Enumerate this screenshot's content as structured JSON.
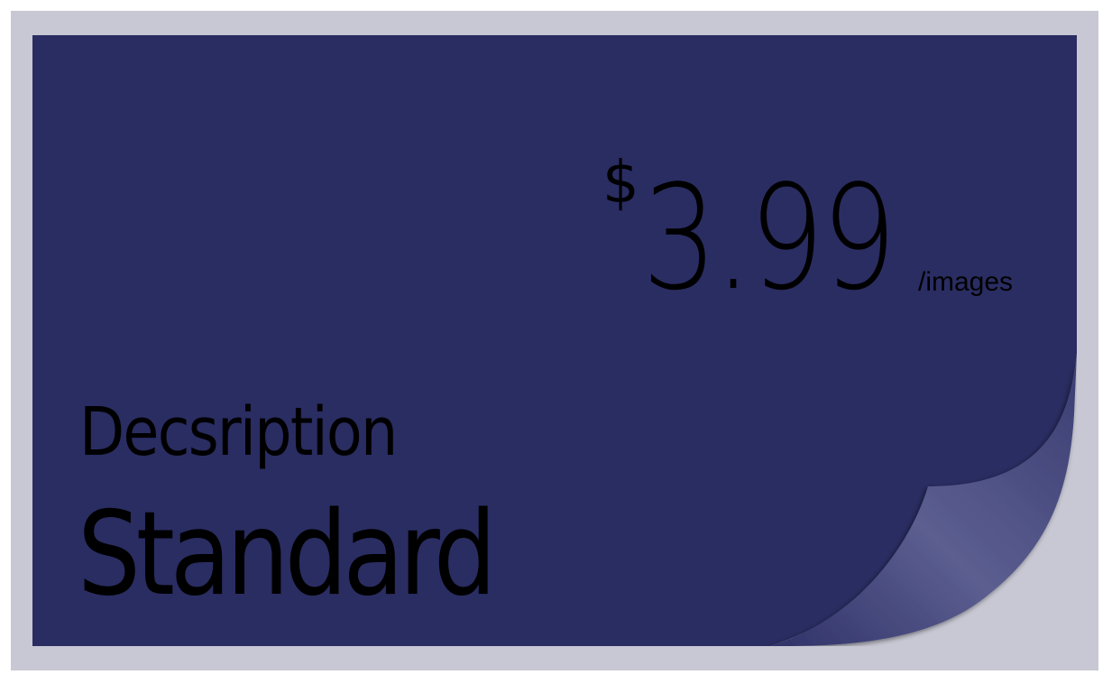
{
  "pricing_card": {
    "currency_symbol": "$",
    "price": "3.99",
    "unit": "/images",
    "description_label": "Decsription",
    "plan_name": "Standard"
  },
  "colors": {
    "frame": "#c8c8d4",
    "card": "#2a2d62",
    "curl_light": "#5a5c8e",
    "text": "#000000"
  },
  "icons": {
    "corner": "page-curl-icon"
  }
}
